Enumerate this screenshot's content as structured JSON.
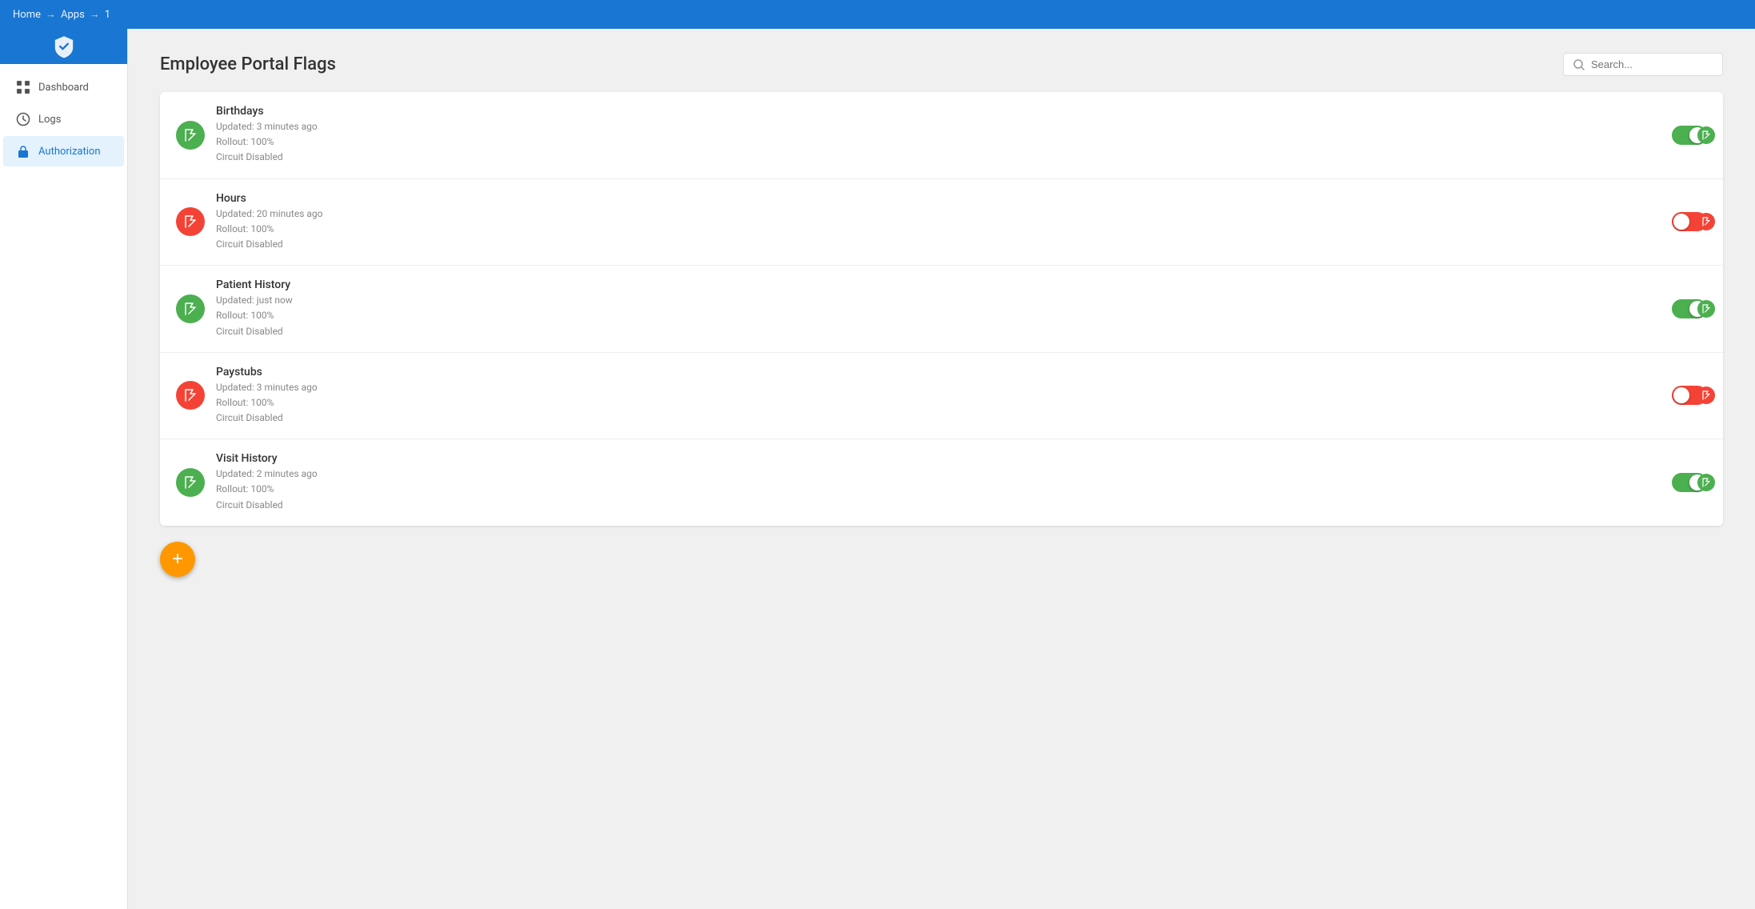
{
  "topNav": {
    "breadcrumbs": [
      "Home",
      "Apps",
      "1"
    ]
  },
  "sidebar": {
    "items": [
      {
        "id": "dashboard",
        "label": "Dashboard",
        "icon": "grid-icon"
      },
      {
        "id": "logs",
        "label": "Logs",
        "icon": "clock-icon"
      },
      {
        "id": "authorization",
        "label": "Authorization",
        "icon": "lock-icon",
        "active": true
      }
    ]
  },
  "pageTitle": "Employee Portal Flags",
  "search": {
    "placeholder": "Search..."
  },
  "flags": [
    {
      "id": "birthdays",
      "name": "Birthdays",
      "updated": "Updated: 3 minutes ago",
      "rollout": "Rollout: 100%",
      "circuit": "Circuit Disabled",
      "iconColor": "green",
      "toggleState": "on"
    },
    {
      "id": "hours",
      "name": "Hours",
      "updated": "Updated: 20 minutes ago",
      "rollout": "Rollout: 100%",
      "circuit": "Circuit Disabled",
      "iconColor": "red",
      "toggleState": "off"
    },
    {
      "id": "patient-history",
      "name": "Patient History",
      "updated": "Updated: just now",
      "rollout": "Rollout: 100%",
      "circuit": "Circuit Disabled",
      "iconColor": "green",
      "toggleState": "on"
    },
    {
      "id": "paystubs",
      "name": "Paystubs",
      "updated": "Updated: 3 minutes ago",
      "rollout": "Rollout: 100%",
      "circuit": "Circuit Disabled",
      "iconColor": "red",
      "toggleState": "off"
    },
    {
      "id": "visit-history",
      "name": "Visit History",
      "updated": "Updated: 2 minutes ago",
      "rollout": "Rollout: 100%",
      "circuit": "Circuit Disabled",
      "iconColor": "green",
      "toggleState": "on"
    }
  ],
  "fab": {
    "label": "+"
  }
}
